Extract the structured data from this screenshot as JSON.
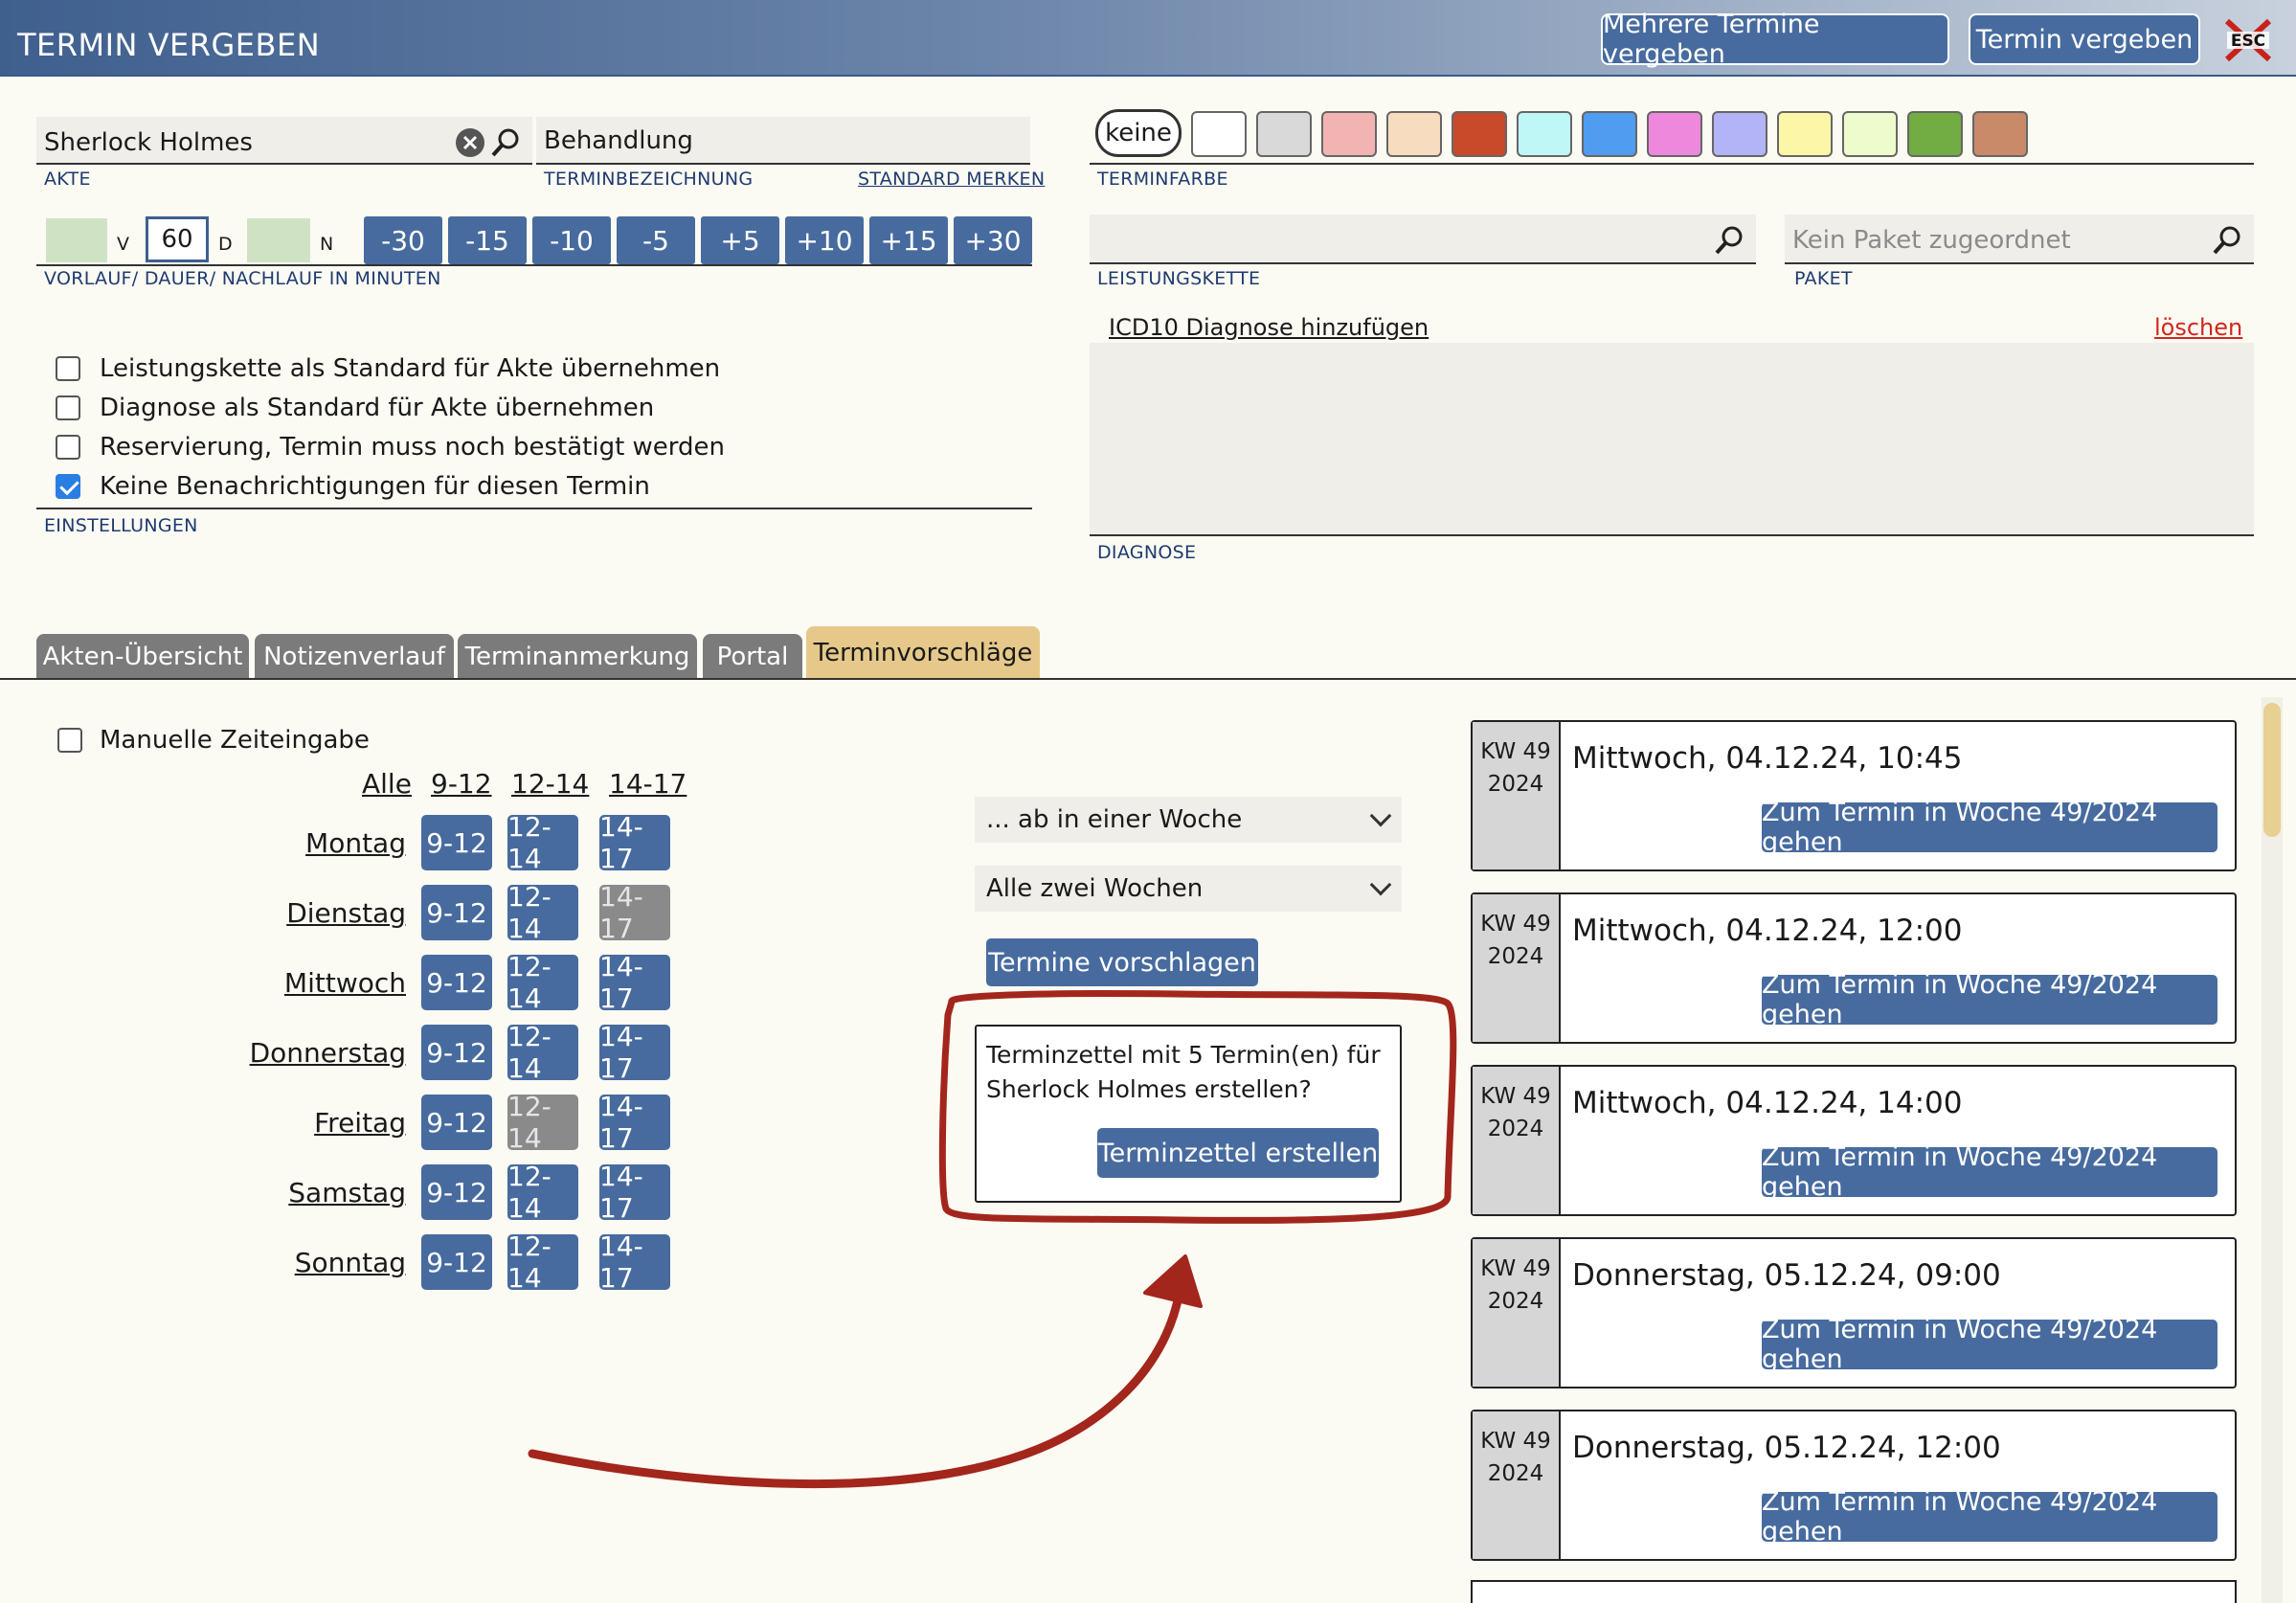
{
  "header": {
    "title": "TERMIN VERGEBEN",
    "multi_button": "Mehrere Termine vergeben",
    "single_button": "Termin vergeben",
    "esc_label": "ESC"
  },
  "akte": {
    "value": "Sherlock Holmes",
    "label": "AKTE"
  },
  "terminbezeichnung": {
    "value": "Behandlung",
    "label": "TERMINBEZEICHNUNG",
    "link": "STANDARD MERKEN"
  },
  "duration": {
    "v_label": "V",
    "d_label": "D",
    "n_label": "N",
    "vorlauf": "",
    "dauer": "60",
    "nachlauf": "",
    "label": "VORLAUF/ DAUER/ NACHLAUF IN MINUTEN",
    "steps": [
      "-30",
      "-15",
      "-10",
      "-5",
      "+5",
      "+10",
      "+15",
      "+30"
    ]
  },
  "terminfarbe": {
    "label": "TERMINFARBE",
    "none_label": "keine",
    "swatches": [
      "#ffffff",
      "#d9d9d9",
      "#f2b3b3",
      "#f7dcbf",
      "#c84a2a",
      "#bff7f7",
      "#4f9cf0",
      "#ee88dd",
      "#b3b3f7",
      "#fbf7a6",
      "#eefbcc",
      "#71ad43",
      "#c98a6a"
    ]
  },
  "leistungskette": {
    "value": "",
    "label": "LEISTUNGSKETTE"
  },
  "paket": {
    "placeholder": "Kein Paket zugeordnet",
    "label": "PAKET"
  },
  "diagnose": {
    "add_link": "ICD10 Diagnose hinzufügen",
    "delete_link": "löschen",
    "label": "DIAGNOSE"
  },
  "einstellungen": {
    "label": "EINSTELLUNGEN",
    "options": [
      {
        "text": "Leistungskette als Standard für Akte übernehmen",
        "checked": false
      },
      {
        "text": "Diagnose als Standard für Akte übernehmen",
        "checked": false
      },
      {
        "text": "Reservierung, Termin muss noch bestätigt werden",
        "checked": false
      },
      {
        "text": "Keine Benachrichtigungen für diesen Termin",
        "checked": true
      }
    ]
  },
  "tabs": [
    "Akten-Übersicht",
    "Notizenverlauf",
    "Terminanmerkung",
    "Portal",
    "Terminvorschläge"
  ],
  "active_tab": "Terminvorschläge",
  "vorschlaege": {
    "manual_label": "Manuelle Zeiteingabe",
    "col_all": "Alle",
    "columns": [
      "9-12",
      "12-14",
      "14-17"
    ],
    "days": [
      {
        "name": "Montag",
        "enabled": [
          true,
          true,
          true
        ]
      },
      {
        "name": "Dienstag",
        "enabled": [
          true,
          true,
          false
        ]
      },
      {
        "name": "Mittwoch",
        "enabled": [
          true,
          true,
          true
        ]
      },
      {
        "name": "Donnerstag",
        "enabled": [
          true,
          true,
          true
        ]
      },
      {
        "name": "Freitag",
        "enabled": [
          true,
          false,
          true
        ]
      },
      {
        "name": "Samstag",
        "enabled": [
          true,
          true,
          true
        ]
      },
      {
        "name": "Sonntag",
        "enabled": [
          true,
          true,
          true
        ]
      }
    ],
    "start_select": "... ab in einer Woche",
    "interval_select": "Alle zwei Wochen",
    "suggest_button": "Termine vorschlagen",
    "sheet_text_1": "Terminzettel mit 5 Termin(en) für",
    "sheet_text_2": "Sherlock Holmes erstellen?",
    "sheet_button": "Terminzettel erstellen"
  },
  "suggestions": [
    {
      "kw": "KW 49",
      "year": "2024",
      "when": "Mittwoch, 04.12.24, 10:45",
      "button": "Zum Termin in Woche 49/2024 gehen"
    },
    {
      "kw": "KW 49",
      "year": "2024",
      "when": "Mittwoch, 04.12.24, 12:00",
      "button": "Zum Termin in Woche 49/2024 gehen"
    },
    {
      "kw": "KW 49",
      "year": "2024",
      "when": "Mittwoch, 04.12.24, 14:00",
      "button": "Zum Termin in Woche 49/2024 gehen"
    },
    {
      "kw": "KW 49",
      "year": "2024",
      "when": "Donnerstag, 05.12.24, 09:00",
      "button": "Zum Termin in Woche 49/2024 gehen"
    },
    {
      "kw": "KW 49",
      "year": "2024",
      "when": "Donnerstag, 05.12.24, 12:00",
      "button": "Zum Termin in Woche 49/2024 gehen"
    }
  ],
  "colors": {
    "primary": "#476b9e",
    "tab_active": "#e6c98a",
    "annotation": "#a3261c",
    "delete": "#d0281c"
  }
}
